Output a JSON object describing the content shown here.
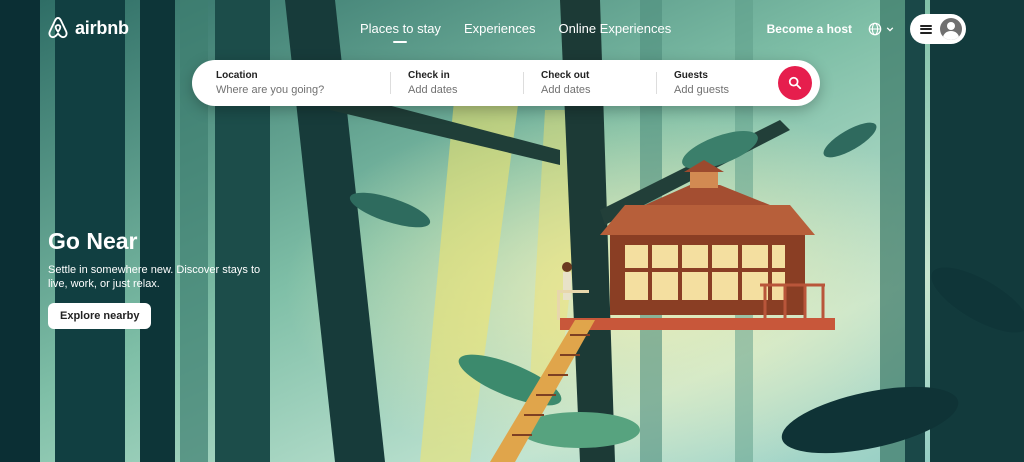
{
  "brand": {
    "name": "airbnb",
    "color": "#ff385c",
    "logo_icon": "airbnb-belo-icon"
  },
  "nav": {
    "items": [
      {
        "label": "Places to stay",
        "active": true
      },
      {
        "label": "Experiences",
        "active": false
      },
      {
        "label": "Online Experiences",
        "active": false
      }
    ]
  },
  "header_right": {
    "become_host": "Become a host",
    "globe_icon": "globe-icon",
    "menu_icon": "hamburger-menu-icon",
    "avatar_icon": "user-avatar-icon"
  },
  "search": {
    "location": {
      "label": "Location",
      "placeholder": "Where are you going?"
    },
    "check_in": {
      "label": "Check in",
      "placeholder": "Add dates"
    },
    "check_out": {
      "label": "Check out",
      "placeholder": "Add dates"
    },
    "guests": {
      "label": "Guests",
      "placeholder": "Add guests"
    },
    "button_icon": "search-icon",
    "button_color": "#e61e4d"
  },
  "hero": {
    "title": "Go Near",
    "subtitle": "Settle in somewhere new. Discover stays to live, work, or just relax.",
    "cta_label": "Explore nearby"
  }
}
